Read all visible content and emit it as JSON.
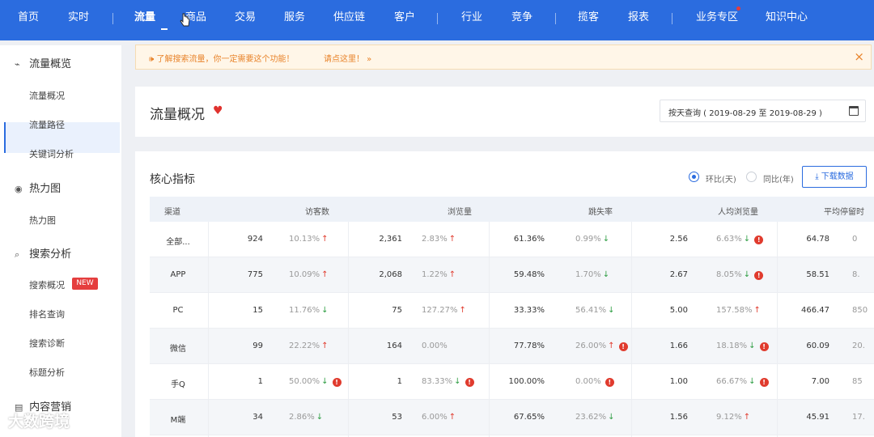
{
  "topnav": {
    "items": [
      "首页",
      "实时",
      "流量",
      "商品",
      "交易",
      "服务",
      "供应链",
      "客户",
      "行业",
      "竞争",
      "揽客",
      "报表",
      "业务专区",
      "知识中心"
    ]
  },
  "sidebar": {
    "groups": [
      {
        "label": "流量概览",
        "icon": "pulse-icon"
      },
      {
        "label": "热力图",
        "icon": "heatmap-icon"
      },
      {
        "label": "搜索分析",
        "icon": "search-icon"
      },
      {
        "label": "内容营销",
        "icon": "document-icon"
      }
    ],
    "subs": [
      "流量概况",
      "流量路径",
      "关键词分析",
      "热力图",
      "搜索概况",
      "排名查询",
      "搜索诊断",
      "标题分析"
    ],
    "badge": "NEW"
  },
  "banner": {
    "text": "🕪  了解搜索流量，你一定需要这个功能！",
    "link": "请点这里！ »",
    "close": "×"
  },
  "header": {
    "title": "流量概况",
    "date_range": "按天查询 ( 2019-08-29 至 2019-08-29 )"
  },
  "core": {
    "title": "核心指标",
    "radio_day": "环比(天)",
    "radio_year": "同比(年)",
    "download": "下载数据"
  },
  "table": {
    "headers": [
      "渠道",
      "访客数",
      "浏览量",
      "跳失率",
      "人均浏览量",
      "平均停留时"
    ],
    "rows": [
      {
        "channel": "全部...",
        "visitors": "924",
        "visitors_pct": "10.13%",
        "pv": "2,361",
        "pv_pct": "2.83%",
        "bounce": "61.36%",
        "bounce_pct": "0.99%",
        "avg_pv": "2.56",
        "avg_pv_pct": "6.63%",
        "stay": "64.78",
        "stay_pct": "0"
      },
      {
        "channel": "APP",
        "visitors": "775",
        "visitors_pct": "10.09%",
        "pv": "2,068",
        "pv_pct": "1.22%",
        "bounce": "59.48%",
        "bounce_pct": "1.70%",
        "avg_pv": "2.67",
        "avg_pv_pct": "8.05%",
        "stay": "58.51",
        "stay_pct": "8."
      },
      {
        "channel": "PC",
        "visitors": "15",
        "visitors_pct": "11.76%",
        "pv": "75",
        "pv_pct": "127.27%",
        "bounce": "33.33%",
        "bounce_pct": "56.41%",
        "avg_pv": "5.00",
        "avg_pv_pct": "157.58%",
        "stay": "466.47",
        "stay_pct": "850"
      },
      {
        "channel": "微信",
        "visitors": "99",
        "visitors_pct": "22.22%",
        "pv": "164",
        "pv_pct": "0.00%",
        "bounce": "77.78%",
        "bounce_pct": "26.00%",
        "avg_pv": "1.66",
        "avg_pv_pct": "18.18%",
        "stay": "60.09",
        "stay_pct": "20."
      },
      {
        "channel": "手Q",
        "visitors": "1",
        "visitors_pct": "50.00%",
        "pv": "1",
        "pv_pct": "83.33%",
        "bounce": "100.00%",
        "bounce_pct": "0.00%",
        "avg_pv": "1.00",
        "avg_pv_pct": "66.67%",
        "stay": "7.00",
        "stay_pct": "85"
      },
      {
        "channel": "M端",
        "visitors": "34",
        "visitors_pct": "2.86%",
        "pv": "53",
        "pv_pct": "6.00%",
        "bounce": "67.65%",
        "bounce_pct": "23.62%",
        "avg_pv": "1.56",
        "avg_pv_pct": "9.12%",
        "stay": "45.91",
        "stay_pct": "17."
      }
    ]
  },
  "watermark": "大数跨境",
  "colors": {
    "primary": "#2b6cdf",
    "up": "#e03b2e",
    "down": "#2f9e44",
    "warning": "#e8832a"
  }
}
